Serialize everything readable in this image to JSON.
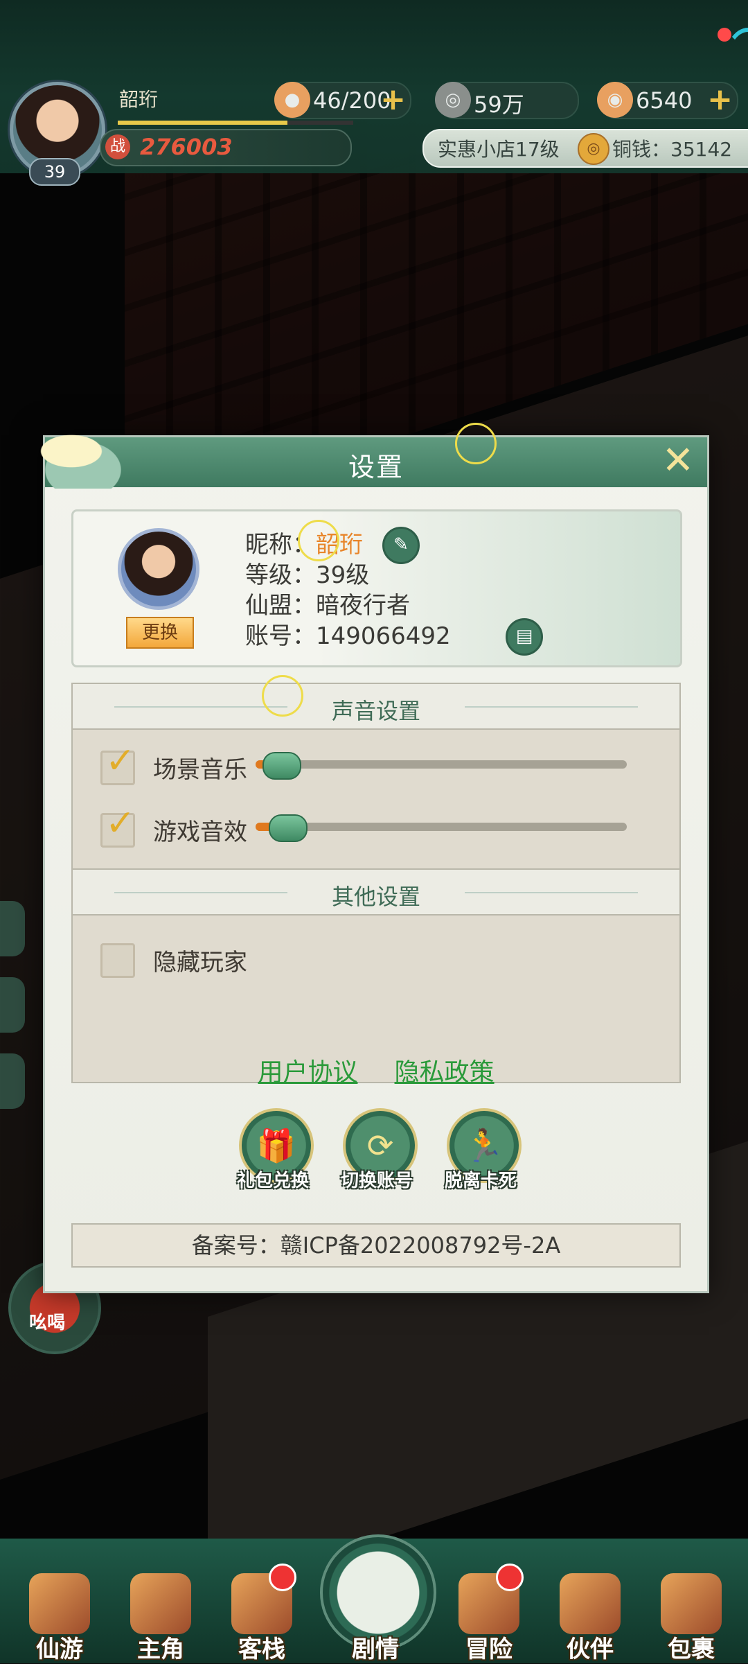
{
  "hud": {
    "player_name": "韶珩",
    "level": "39",
    "power": "276003",
    "power_icon": "战",
    "exp_fraction": 0.72,
    "stamina": "46/200",
    "silver": "59万",
    "jade": "6540",
    "shop_level": "实惠小店17级",
    "copper": "铜钱：35142"
  },
  "dialog": {
    "title": "设置",
    "profile": {
      "change_button": "更换",
      "nickname_label": "昵称：",
      "nickname_value": "韶珩",
      "level_label": "等级：",
      "level_value": "39级",
      "guild_label": "仙盟：",
      "guild_value": "暗夜行者",
      "account_label": "账号：",
      "account_value": "149066492"
    },
    "sound_section": {
      "title": "声音设置",
      "options": [
        {
          "label": "场景音乐",
          "checked": true,
          "level": 0.02
        },
        {
          "label": "游戏音效",
          "checked": true,
          "level": 0.04
        }
      ]
    },
    "other_section": {
      "title": "其他设置",
      "hide_players_label": "隐藏玩家",
      "hide_players_checked": false
    },
    "links": {
      "user_agreement": "用户协议",
      "privacy_policy": "隐私政策"
    },
    "actions": [
      {
        "label": "礼包兑换",
        "icon": "gift-icon"
      },
      {
        "label": "切换账号",
        "icon": "switch-icon"
      },
      {
        "label": "脱离卡死",
        "icon": "run-icon"
      }
    ],
    "icp": "备案号：赣ICP备2022008792号-2A"
  },
  "side": {
    "yell_label": "吆喝"
  },
  "nav": {
    "items": [
      {
        "label": "仙游",
        "badge": false
      },
      {
        "label": "主角",
        "badge": false
      },
      {
        "label": "客栈",
        "badge": true
      },
      {
        "label": "剧情",
        "badge": false
      },
      {
        "label": "冒险",
        "badge": true
      },
      {
        "label": "伙伴",
        "badge": false
      },
      {
        "label": "包裹",
        "badge": false
      }
    ]
  },
  "colors": {
    "accent_green": "#3f7a60",
    "link_green": "#2a9a3a",
    "check_gold": "#e2ad2a",
    "name_orange": "#e8852a"
  }
}
